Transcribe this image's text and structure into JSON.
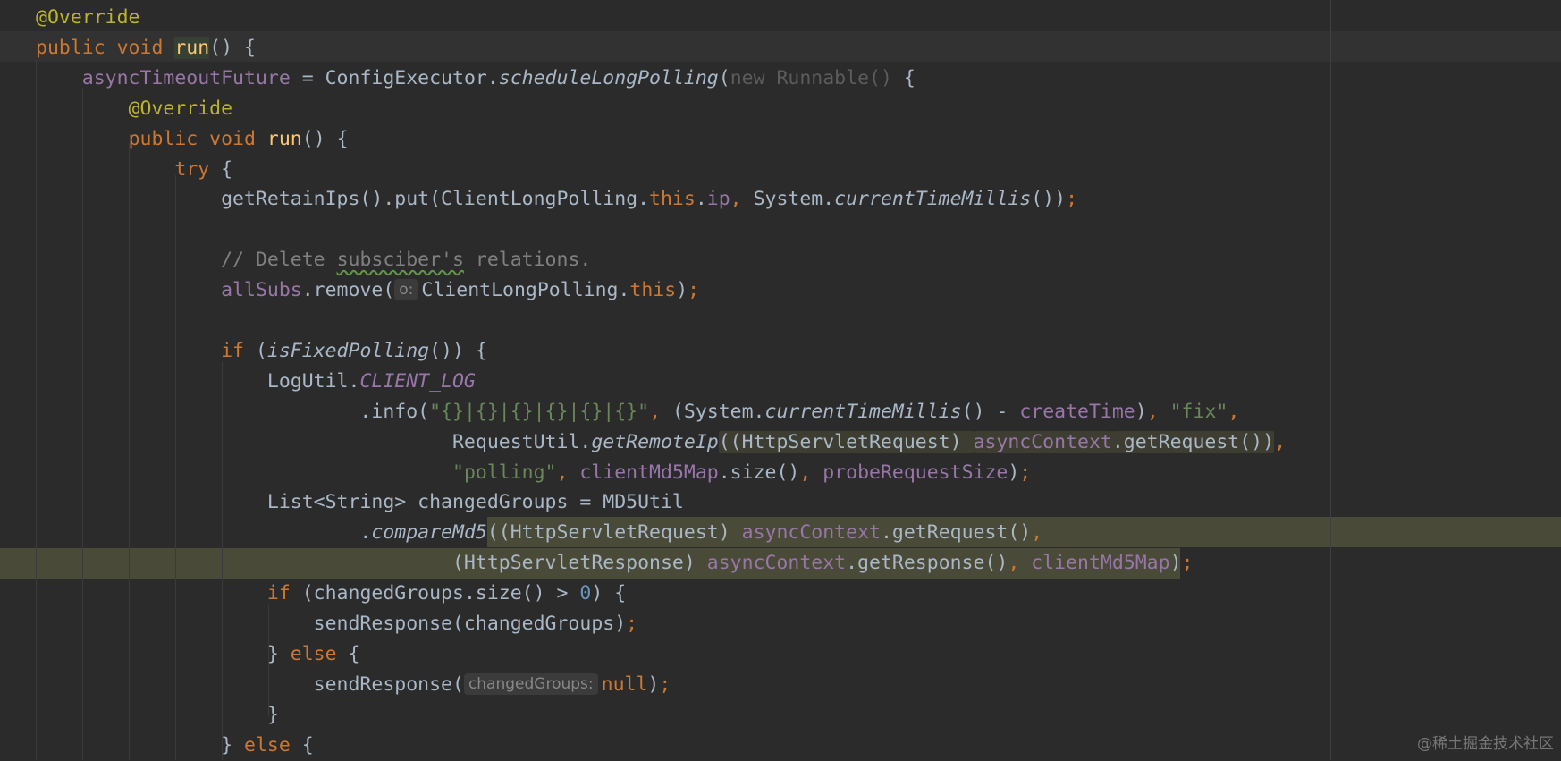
{
  "editor": {
    "lines": [
      {
        "segments": [
          {
            "t": "@Override",
            "c": "ann"
          }
        ]
      },
      {
        "segments": [
          {
            "t": "public void ",
            "c": "kw"
          },
          {
            "t": "run",
            "c": "run-hl"
          },
          {
            "t": "() {",
            "c": ""
          }
        ]
      },
      {
        "segments": [
          {
            "t": "    "
          },
          {
            "t": "asyncTimeoutFuture",
            "c": "fld"
          },
          {
            "t": " = ConfigExecutor."
          },
          {
            "t": "scheduleLongPolling",
            "c": "ital"
          },
          {
            "t": "("
          },
          {
            "t": "new Runnable() ",
            "c": "grey"
          },
          {
            "t": "{"
          }
        ]
      },
      {
        "segments": [
          {
            "t": "        "
          },
          {
            "t": "@Override",
            "c": "ann"
          }
        ]
      },
      {
        "segments": [
          {
            "t": "        "
          },
          {
            "t": "public void ",
            "c": "kw"
          },
          {
            "t": "run",
            "c": "fn"
          },
          {
            "t": "() {"
          }
        ]
      },
      {
        "segments": [
          {
            "t": "            "
          },
          {
            "t": "try",
            "c": "kw"
          },
          {
            "t": " {"
          }
        ]
      },
      {
        "segments": [
          {
            "t": "                getRetainIps().put(ClientLongPolling."
          },
          {
            "t": "this",
            "c": "kw"
          },
          {
            "t": "."
          },
          {
            "t": "ip",
            "c": "fld"
          },
          {
            "t": ", ",
            "c": "kw"
          },
          {
            "t": "System."
          },
          {
            "t": "currentTimeMillis",
            "c": "ital"
          },
          {
            "t": "())"
          },
          {
            "t": ";",
            "c": "kw"
          }
        ]
      },
      {
        "segments": [
          {
            "t": ""
          }
        ]
      },
      {
        "segments": [
          {
            "t": "                "
          },
          {
            "t": "// Delete ",
            "c": "com"
          },
          {
            "t": "subsciber's",
            "c": "com typo"
          },
          {
            "t": " relations.",
            "c": "com"
          }
        ]
      },
      {
        "segments": [
          {
            "t": "                "
          },
          {
            "t": "allSubs",
            "c": "fld"
          },
          {
            "t": ".remove("
          },
          {
            "t": "o:",
            "c": "hint"
          },
          {
            "t": "ClientLongPolling."
          },
          {
            "t": "this",
            "c": "kw"
          },
          {
            "t": ")"
          },
          {
            "t": ";",
            "c": "kw"
          }
        ]
      },
      {
        "segments": [
          {
            "t": ""
          }
        ]
      },
      {
        "segments": [
          {
            "t": "                "
          },
          {
            "t": "if",
            "c": "kw"
          },
          {
            "t": " ("
          },
          {
            "t": "isFixedPolling",
            "c": "ital"
          },
          {
            "t": "()) {"
          }
        ]
      },
      {
        "segments": [
          {
            "t": "                    LogUtil."
          },
          {
            "t": "CLIENT_LOG",
            "c": "fld ital"
          }
        ]
      },
      {
        "segments": [
          {
            "t": "                            .info("
          },
          {
            "t": "\"{}|{}|{}|{}|{}|{}\"",
            "c": "str"
          },
          {
            "t": ", ",
            "c": "kw"
          },
          {
            "t": "(System."
          },
          {
            "t": "currentTimeMillis",
            "c": "ital"
          },
          {
            "t": "() - "
          },
          {
            "t": "createTime",
            "c": "fld"
          },
          {
            "t": ")"
          },
          {
            "t": ", ",
            "c": "kw"
          },
          {
            "t": "\"fix\"",
            "c": "str"
          },
          {
            "t": ",",
            "c": "kw"
          }
        ]
      },
      {
        "segments": [
          {
            "t": "                                    RequestUtil."
          },
          {
            "t": "getRemoteIp",
            "c": "ital"
          },
          {
            "t": "((HttpServletRequest) ",
            "c": "box-hl"
          },
          {
            "t": "asyncContext",
            "c": "fld box-hl"
          },
          {
            "t": ".getRequest())",
            "c": "box-hl"
          },
          {
            "t": ",",
            "c": "kw"
          }
        ]
      },
      {
        "segments": [
          {
            "t": "                                    "
          },
          {
            "t": "\"polling\"",
            "c": "str"
          },
          {
            "t": ", ",
            "c": "kw"
          },
          {
            "t": "clientMd5Map",
            "c": "fld"
          },
          {
            "t": ".size()"
          },
          {
            "t": ", ",
            "c": "kw"
          },
          {
            "t": "probeRequestSize",
            "c": "fld"
          },
          {
            "t": ")"
          },
          {
            "t": ";",
            "c": "kw"
          }
        ]
      },
      {
        "segments": [
          {
            "t": "                    List<String> changedGroups = MD5Util"
          }
        ]
      },
      {
        "segments": [
          {
            "t": "                            ."
          },
          {
            "t": "compareMd5",
            "c": "ital"
          },
          {
            "t": "((HttpServletRequest) "
          },
          {
            "t": "asyncContext",
            "c": "fld"
          },
          {
            "t": ".getRequest()"
          },
          {
            "t": ",",
            "c": "kw"
          }
        ]
      },
      {
        "segments": [
          {
            "t": "                                    (HttpServletResponse) "
          },
          {
            "t": "asyncContext",
            "c": "fld"
          },
          {
            "t": ".getResponse()"
          },
          {
            "t": ", ",
            "c": "kw"
          },
          {
            "t": "clientMd5Map",
            "c": "fld"
          },
          {
            "t": ")"
          },
          {
            "t": ";",
            "c": "kw"
          }
        ]
      },
      {
        "segments": [
          {
            "t": "                    "
          },
          {
            "t": "if",
            "c": "kw"
          },
          {
            "t": " (changedGroups.size() > "
          },
          {
            "t": "0",
            "c": "num"
          },
          {
            "t": ") {"
          }
        ]
      },
      {
        "segments": [
          {
            "t": "                        sendResponse(changedGroups)"
          },
          {
            "t": ";",
            "c": "kw"
          }
        ]
      },
      {
        "segments": [
          {
            "t": "                    } "
          },
          {
            "t": "else",
            "c": "kw"
          },
          {
            "t": " {"
          }
        ]
      },
      {
        "segments": [
          {
            "t": "                        sendResponse("
          },
          {
            "t": "changedGroups:",
            "c": "hint"
          },
          {
            "t": "null",
            "c": "kw"
          },
          {
            "t": ")"
          },
          {
            "t": ";",
            "c": "kw"
          }
        ]
      },
      {
        "segments": [
          {
            "t": "                    }"
          }
        ]
      },
      {
        "segments": [
          {
            "t": "                } "
          },
          {
            "t": "else",
            "c": "kw"
          },
          {
            "t": " {"
          }
        ]
      }
    ]
  },
  "watermark": "@稀土掘金技术社区"
}
